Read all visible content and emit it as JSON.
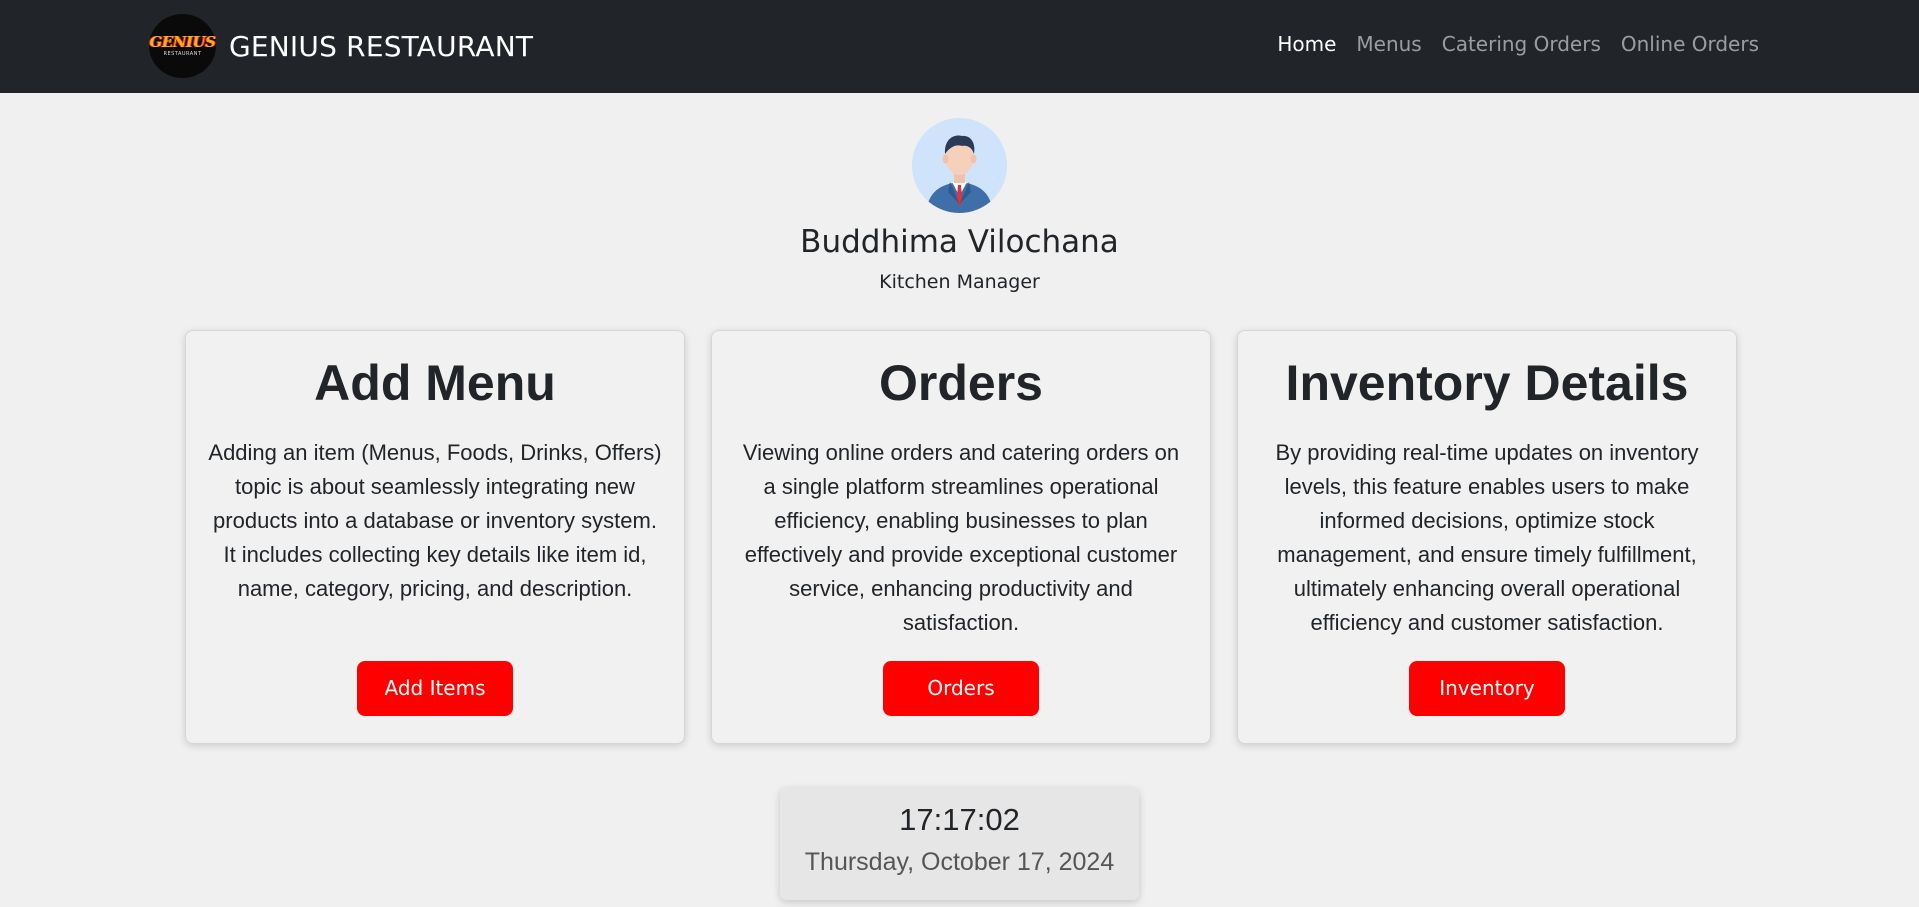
{
  "navbar": {
    "logo_text": "GENIUS",
    "logo_sub": "RESTAURANT",
    "brand": "GENIUS RESTAURANT",
    "links": [
      {
        "label": "Home",
        "active": true
      },
      {
        "label": "Menus",
        "active": false
      },
      {
        "label": "Catering Orders",
        "active": false
      },
      {
        "label": "Online Orders",
        "active": false
      }
    ]
  },
  "profile": {
    "avatar_icon": "businessman-avatar-icon",
    "name": "Buddhima Vilochana",
    "role": "Kitchen Manager"
  },
  "cards": [
    {
      "title": "Add Menu",
      "description": "Adding an item (Menus, Foods, Drinks, Offers) topic is about seamlessly integrating new products into a database or inventory system. It includes collecting key details like item id, name, category, pricing, and description.",
      "button": "Add Items"
    },
    {
      "title": "Orders",
      "description": "Viewing online orders and catering orders on a single platform streamlines operational efficiency, enabling businesses to plan effectively and provide exceptional customer service, enhancing productivity and satisfaction.",
      "button": "Orders"
    },
    {
      "title": "Inventory Details",
      "description": "By providing real-time updates on inventory levels, this feature enables users to make informed decisions, optimize stock management, and ensure timely fulfillment, ultimately enhancing overall operational efficiency and customer satisfaction.",
      "button": "Inventory"
    }
  ],
  "clock": {
    "time": "17:17:02",
    "date": "Thursday, October 17, 2024"
  },
  "colors": {
    "navbar_bg": "#212529",
    "page_bg": "#f0f0f0",
    "accent_button": "#ff0000"
  }
}
